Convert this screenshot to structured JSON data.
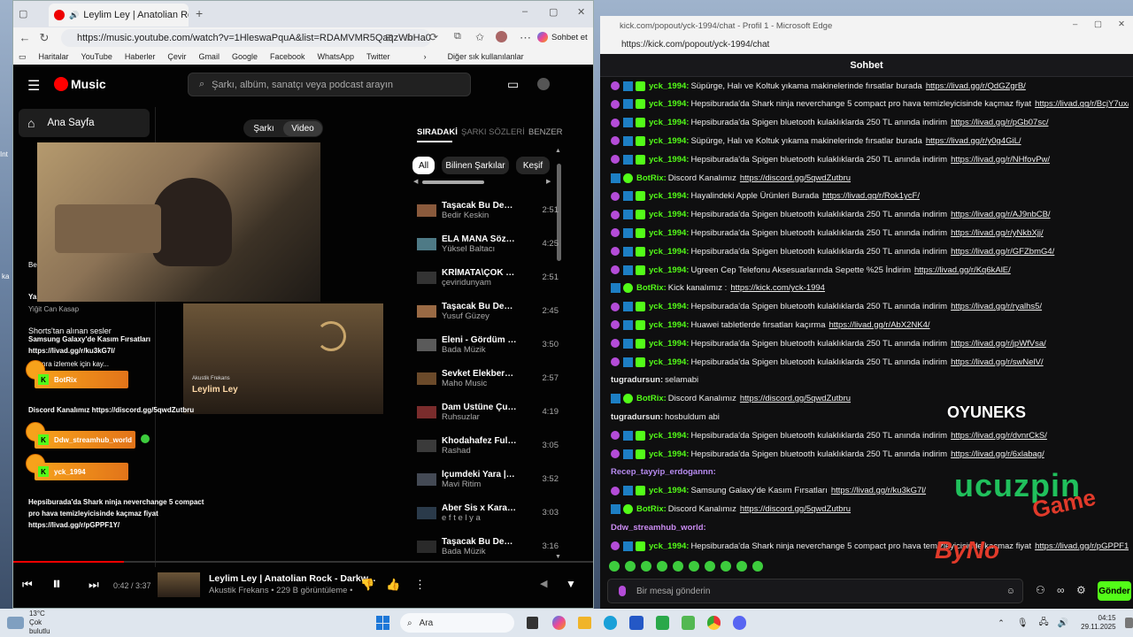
{
  "left": {
    "tab_title": "Leylim Ley | Anatolian Rock",
    "url": "https://music.youtube.com/watch?v=1HleswaPquA&list=RDAMVMR5QaqzWbHa0",
    "sohbet_btn": "Sohbet et",
    "bookmarks": [
      "Haritalar",
      "YouTube",
      "Haberler",
      "Çevir",
      "Gmail",
      "Google",
      "Facebook",
      "WhatsApp",
      "Twitter"
    ],
    "bookmarks_other": "Diğer sık kullanılanlar",
    "logo": "Music",
    "search_placeholder": "Şarkı, albüm, sanatçı veya podcast arayın",
    "sidebar_home": "Ana Sayfa",
    "toggle": [
      "Şarkı",
      "Video"
    ],
    "queue_tabs": [
      "SIRADAKİ",
      "ŞARKI SÖZLERİ",
      "BENZER"
    ],
    "chips": [
      "All",
      "Bilinen Şarkılar",
      "Keşif"
    ],
    "queue": [
      {
        "title": "Taşacak Bu Deniz ...",
        "artist": "Bedir Keskin",
        "dur": "2:51",
        "c": "#8a5a3c"
      },
      {
        "title": "ELA MANA Söz&M...",
        "artist": "Yüksel Baltacı",
        "dur": "4:25",
        "c": "#4e7a86"
      },
      {
        "title": "KRİMATA\\ÇOK YA...",
        "artist": "çeviridunyam",
        "dur": "2:51",
        "c": "#333333"
      },
      {
        "title": "Taşacak Bu Deniz ...",
        "artist": "Yusuf Güzey",
        "dur": "2:45",
        "c": "#9a6a44"
      },
      {
        "title": "Eleni - Gördüm Se...",
        "artist": "Bada Müzik",
        "dur": "3:50",
        "c": "#5a5a5a"
      },
      {
        "title": "Sevket Elekberova...",
        "artist": "Maho Music",
        "dur": "2:57",
        "c": "#6b4a2a"
      },
      {
        "title": "Dam Üstüne Çul S...",
        "artist": "Ruhsuzlar",
        "dur": "4:19",
        "c": "#7a2c2c"
      },
      {
        "title": "Khodahafez Full V...",
        "artist": "Rashad",
        "dur": "3:05",
        "c": "#3a3a3a"
      },
      {
        "title": "İçumdeki Yara | Ta...",
        "artist": "Mavi Ritim",
        "dur": "3:52",
        "c": "#444a55"
      },
      {
        "title": "Aber Sis x Kara Se...",
        "artist": "e f t e l y a",
        "dur": "3:03",
        "c": "#2a3a4a"
      },
      {
        "title": "Taşacak Bu Deniz ...",
        "artist": "Bada Müzik",
        "dur": "3:16",
        "c": "#2a2a2a"
      }
    ],
    "overlay": {
      "ba": "Be",
      "ya": "Ya",
      "yigit": "Yiğit Can Kasap",
      "shorts": "Shorts'tan alınan sesler",
      "galaxy": "Samsung Galaxy'de Kasım Fırsatları",
      "galaxy_link": "https://livad.gg/r/ku3kG7l/",
      "later": "a sonra izlemek için kay...",
      "botrix": "BotRix",
      "discord": "Discord Kanalımız https://discord.gg/5qwdZutbru",
      "ddw": "Ddw_streamhub_world",
      "yck": "yck_1994",
      "shark1": "Hepsiburada'da Shark ninja neverchange 5 compact",
      "shark2": "pro hava temizleyicisinde kaçmaz fiyat",
      "shark3": "https://livad.gg/r/pGPPF1Y/",
      "album_small": "Akustik Frekans",
      "album_big": "Leylim Ley"
    },
    "player": {
      "time": "0:42 / 3:37",
      "title": "Leylim Ley | Anatolian Rock - Darkw...",
      "sub": "Akustik Frekans • 229 B görüntüleme •"
    }
  },
  "right": {
    "window_title": "kick.com/popout/yck-1994/chat - Profil 1 - Microsoft Edge",
    "url": "https://kick.com/popout/yck-1994/chat",
    "header": "Sohbet",
    "messages": [
      {
        "badges": "yck",
        "user": "yck_1994:",
        "color": "#53fc18",
        "text": "Süpürge, Halı ve Koltuk yıkama makinelerinde fırsatlar burada",
        "link": "https://livad.gg/r/QdGZgrB/"
      },
      {
        "badges": "yck",
        "user": "yck_1994:",
        "color": "#53fc18",
        "text": "Hepsiburada'da Shark ninja neverchange 5 compact pro hava temizleyicisinde kaçmaz fiyat",
        "link": "https://livad.gg/r/BcjY7ux/"
      },
      {
        "badges": "yck",
        "user": "yck_1994:",
        "color": "#53fc18",
        "text": "Hepsiburada'da Spigen bluetooth kulaklıklarda 250 TL anında indirim",
        "link": "https://livad.gg/r/pGb07sc/"
      },
      {
        "badges": "yck",
        "user": "yck_1994:",
        "color": "#53fc18",
        "text": "Süpürge, Halı ve Koltuk yıkama makinelerinde fırsatlar burada",
        "link": "https://livad.gg/r/y0g4GiL/"
      },
      {
        "badges": "yck",
        "user": "yck_1994:",
        "color": "#53fc18",
        "text": "Hepsiburada'da Spigen bluetooth kulaklıklarda 250 TL anında indirim",
        "link": "https://livad.gg/r/NHfovPw/"
      },
      {
        "badges": "bot",
        "user": "BotRix:",
        "color": "#53fc18",
        "text": "Discord Kanalımız",
        "link": "https://discord.gg/5qwdZutbru"
      },
      {
        "badges": "yck",
        "user": "yck_1994:",
        "color": "#53fc18",
        "text": "Hayalindeki Apple Ürünleri Burada",
        "link": "https://livad.gg/r/Rok1ycF/"
      },
      {
        "badges": "yck",
        "user": "yck_1994:",
        "color": "#53fc18",
        "text": "Hepsiburada'da Spigen bluetooth kulaklıklarda 250 TL anında indirim",
        "link": "https://livad.gg/r/AJ9nbCB/"
      },
      {
        "badges": "yck",
        "user": "yck_1994:",
        "color": "#53fc18",
        "text": "Hepsiburada'da Spigen bluetooth kulaklıklarda 250 TL anında indirim",
        "link": "https://livad.gg/r/yNkbXjj/"
      },
      {
        "badges": "yck",
        "user": "yck_1994:",
        "color": "#53fc18",
        "text": "Hepsiburada'da Spigen bluetooth kulaklıklarda 250 TL anında indirim",
        "link": "https://livad.gg/r/GFZbmG4/"
      },
      {
        "badges": "yck",
        "user": "yck_1994:",
        "color": "#53fc18",
        "text": "Ugreen Cep Telefonu Aksesuarlarında Sepette %25 İndirim",
        "link": "https://livad.gg/r/Kq6kAlE/"
      },
      {
        "badges": "bot",
        "user": "BotRix:",
        "color": "#53fc18",
        "text": "Kick kanalımız :",
        "link": "https://kick.com/yck-1994"
      },
      {
        "badges": "yck",
        "user": "yck_1994:",
        "color": "#53fc18",
        "text": "Hepsiburada'da Spigen bluetooth kulaklıklarda 250 TL anında indirim",
        "link": "https://livad.gg/r/ryalhs5/"
      },
      {
        "badges": "yck",
        "user": "yck_1994:",
        "color": "#53fc18",
        "text": "Huawei tabletlerde fırsatları kaçırma",
        "link": "https://livad.gg/r/AbX2NK4/"
      },
      {
        "badges": "yck",
        "user": "yck_1994:",
        "color": "#53fc18",
        "text": "Hepsiburada'da Spigen bluetooth kulaklıklarda 250 TL anında indirim",
        "link": "https://livad.gg/r/jpWfVsa/"
      },
      {
        "badges": "yck",
        "user": "yck_1994:",
        "color": "#53fc18",
        "text": "Hepsiburada'da Spigen bluetooth kulaklıklarda 250 TL anında indirim",
        "link": "https://livad.gg/r/swNelV/"
      },
      {
        "badges": "",
        "user": "tugradursun:",
        "color": "#e6e6e6",
        "text": "selamabi",
        "link": ""
      },
      {
        "badges": "bot",
        "user": "BotRix:",
        "color": "#53fc18",
        "text": "Discord Kanalımız",
        "link": "https://discord.gg/5qwdZutbru"
      },
      {
        "badges": "",
        "user": "tugradursun:",
        "color": "#e6e6e6",
        "text": "hosbuldum abi",
        "link": ""
      },
      {
        "badges": "yck",
        "user": "yck_1994:",
        "color": "#53fc18",
        "text": "Hepsiburada'da Spigen bluetooth kulaklıklarda 250 TL anında indirim",
        "link": "https://livad.gg/r/dvnrCkS/"
      },
      {
        "badges": "yck",
        "user": "yck_1994:",
        "color": "#53fc18",
        "text": "Hepsiburada'da Spigen bluetooth kulaklıklarda 250 TL anında indirim",
        "link": "https://livad.gg/r/6xlabag/"
      },
      {
        "badges": "",
        "user": "Recep_tayyip_erdogannn:",
        "color": "#b78bf0",
        "text": "",
        "link": ""
      },
      {
        "badges": "yck",
        "user": "yck_1994:",
        "color": "#53fc18",
        "text": "Samsung Galaxy'de Kasım Fırsatları",
        "link": "https://livad.gg/r/ku3kG7l/"
      },
      {
        "badges": "bot",
        "user": "BotRix:",
        "color": "#53fc18",
        "text": "Discord Kanalımız",
        "link": "https://discord.gg/5qwdZutbru"
      },
      {
        "badges": "",
        "user": "Ddw_streamhub_world:",
        "color": "#c98bf0",
        "text": "",
        "link": ""
      },
      {
        "badges": "yck",
        "user": "yck_1994:",
        "color": "#53fc18",
        "text": "Hepsiburada'da Shark ninja neverchange 5 compact pro hava temizleyicisinde kaçmaz fiyat",
        "link": "https://livad.gg/r/pGPPF1Y/"
      }
    ],
    "input_placeholder": "Bir mesaj gönderin",
    "send": "Gönder",
    "watermarks": {
      "oyuneks": "OYUNEKS",
      "ucuzpin": "ucuzpin",
      "game": "Game",
      "bynogame": "ByNo"
    }
  },
  "taskbar": {
    "temp": "13°C",
    "weather": "Çok bulutlu",
    "search": "Ara",
    "time": "04:15",
    "date": "29.11.2025"
  },
  "desktop_icons": [
    "Int",
    "ka"
  ]
}
